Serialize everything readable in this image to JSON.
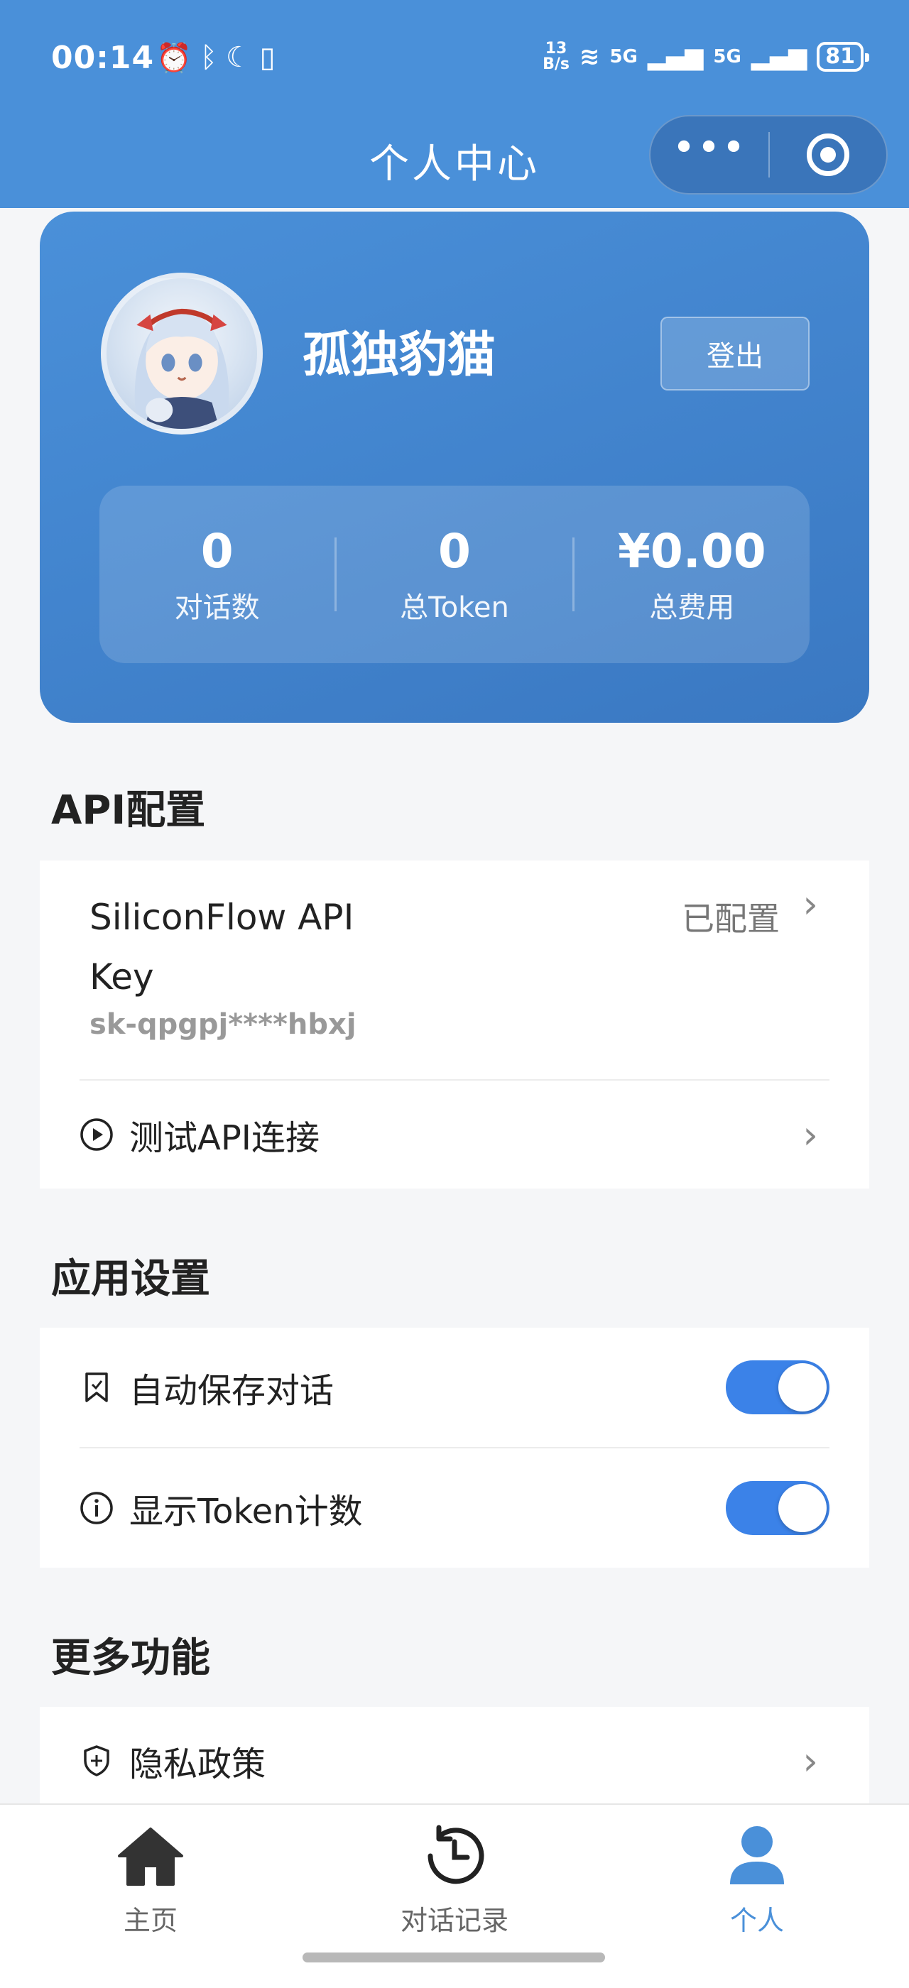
{
  "status_bar": {
    "time": "00:14",
    "left_icons": [
      "alarm-icon",
      "bluetooth-icon",
      "moon-icon",
      "vibrate-icon"
    ],
    "speed_top": "13",
    "speed_bottom": "B/s",
    "signal1": "5G",
    "signal2": "5G",
    "battery": "81"
  },
  "header": {
    "title": "个人中心",
    "more_glyph": "•••",
    "colors": {
      "primary": "#4a90d9",
      "toggle_on": "#3b82e8"
    }
  },
  "profile": {
    "username": "孤独豹猫",
    "logout_label": "登出",
    "stats": [
      {
        "value": "0",
        "label": "对话数"
      },
      {
        "value": "0",
        "label": "总Token"
      },
      {
        "value": "¥0.00",
        "label": "总费用"
      }
    ]
  },
  "api_section": {
    "title": "API配置",
    "key_title": "SiliconFlow API Key",
    "key_status": "已配置",
    "key_masked": "sk-qpgpj****hbxj",
    "test_label": "测试API连接"
  },
  "app_section": {
    "title": "应用设置",
    "items": [
      {
        "label": "自动保存对话",
        "enabled": true
      },
      {
        "label": "显示Token计数",
        "enabled": true
      }
    ]
  },
  "more_section": {
    "title": "更多功能",
    "items": [
      {
        "label": "隐私政策"
      }
    ]
  },
  "tabbar": {
    "items": [
      {
        "label": "主页",
        "icon": "home-icon",
        "active": false
      },
      {
        "label": "对话记录",
        "icon": "history-icon",
        "active": false
      },
      {
        "label": "个人",
        "icon": "person-icon",
        "active": true
      }
    ]
  },
  "chevron": "›"
}
